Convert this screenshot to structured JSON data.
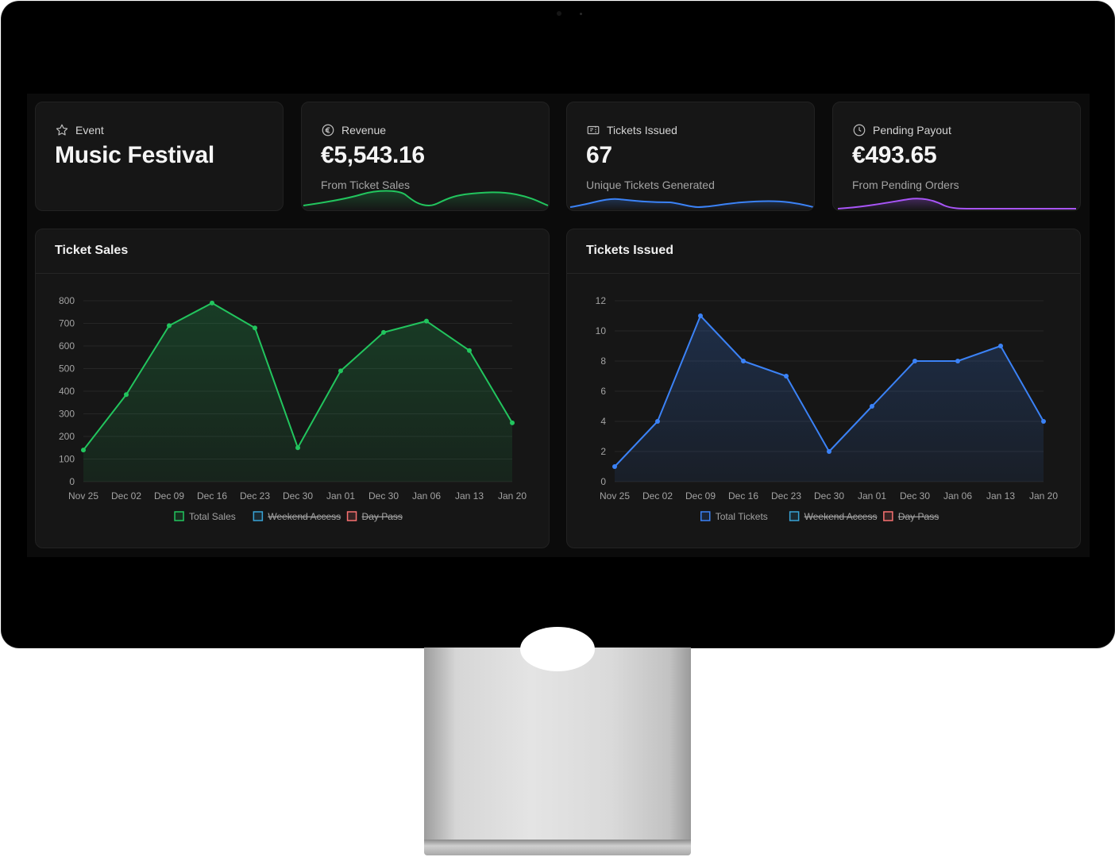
{
  "cards": [
    {
      "label": "Event",
      "value": "Music Festival",
      "sub": "",
      "icon": "star-icon"
    },
    {
      "label": "Revenue",
      "value": "€5,543.16",
      "sub": "From Ticket Sales",
      "icon": "euro-icon",
      "color": "#22c55e"
    },
    {
      "label": "Tickets Issued",
      "value": "67",
      "sub": "Unique Tickets Generated",
      "icon": "ticket-icon",
      "color": "#3b82f6"
    },
    {
      "label": "Pending Payout",
      "value": "€493.65",
      "sub": "From Pending Orders",
      "icon": "clock-icon",
      "color": "#a855f7"
    }
  ],
  "charts": {
    "sales_title": "Ticket Sales",
    "issued_title": "Tickets Issued"
  },
  "chart_data": [
    {
      "type": "area",
      "title": "Ticket Sales",
      "x": [
        "Nov 25",
        "Dec 02",
        "Dec 09",
        "Dec 16",
        "Dec 23",
        "Dec 30",
        "Jan 01",
        "Dec 30",
        "Jan 06",
        "Jan 13",
        "Jan 20"
      ],
      "series": [
        {
          "name": "Total Sales",
          "values": [
            140,
            385,
            690,
            790,
            680,
            150,
            490,
            660,
            710,
            580,
            260
          ],
          "color": "#22c55e"
        }
      ],
      "legend": [
        {
          "name": "Total Sales",
          "color": "#22c55e",
          "hidden": false
        },
        {
          "name": "Weekend Access",
          "color": "#38a3d6",
          "hidden": true
        },
        {
          "name": "Day Pass",
          "color": "#f87171",
          "hidden": true
        }
      ],
      "yticks": [
        0,
        100,
        200,
        300,
        400,
        500,
        600,
        700,
        800
      ],
      "ylim": [
        0,
        800
      ],
      "legend_position": "bottom"
    },
    {
      "type": "area",
      "title": "Tickets Issued",
      "x": [
        "Nov 25",
        "Dec 02",
        "Dec 09",
        "Dec 16",
        "Dec 23",
        "Dec 30",
        "Jan 01",
        "Dec 30",
        "Jan 06",
        "Jan 13",
        "Jan 20"
      ],
      "series": [
        {
          "name": "Total Tickets",
          "values": [
            1,
            4,
            11,
            8,
            7,
            2,
            5,
            8,
            8,
            9,
            4
          ],
          "color": "#3b82f6"
        }
      ],
      "legend": [
        {
          "name": "Total Tickets",
          "color": "#3b82f6",
          "hidden": false
        },
        {
          "name": "Weekend Access",
          "color": "#38a3d6",
          "hidden": true
        },
        {
          "name": "Day Pass",
          "color": "#f87171",
          "hidden": true
        }
      ],
      "yticks": [
        0,
        2,
        4,
        6,
        8,
        10,
        12
      ],
      "ylim": [
        0,
        12
      ],
      "legend_position": "bottom"
    }
  ]
}
